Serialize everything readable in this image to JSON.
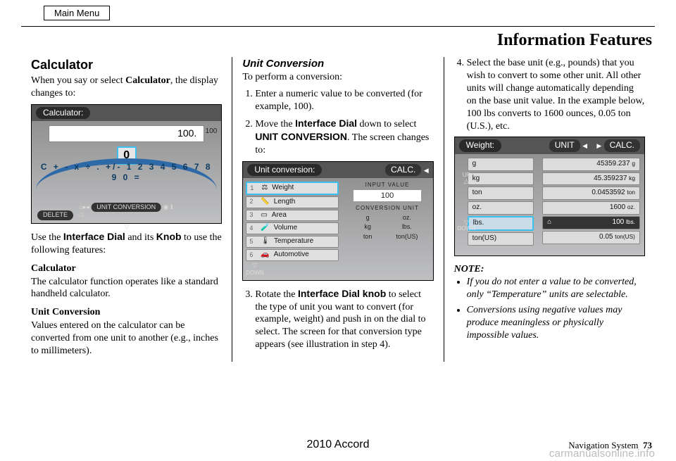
{
  "main_menu_label": "Main Menu",
  "page_title": "Information Features",
  "col1": {
    "h_calculator": "Calculator",
    "intro_pre": "When you say or select ",
    "intro_bold": "Calculator",
    "intro_post": ", the display changes to:",
    "use_pre": "Use the ",
    "use_b1": "Interface Dial",
    "use_mid": " and its ",
    "use_b2": "Knob",
    "use_post": " to use the following features:",
    "sub_calc": "Calculator",
    "sub_calc_text": "The calculator function operates like a standard handheld calculator.",
    "sub_uc": "Unit Conversion",
    "sub_uc_text": "Values entered on the calculator can be converted from one unit to another (e.g., inches to millimeters)."
  },
  "calc_shot": {
    "title": "Calculator:",
    "display_value": "100.",
    "side_value": "100",
    "zero_btn": "0",
    "arc_keys": "C + - x ÷ . +/-  1 2 3 4 5 6 7 8 9 0 =",
    "delete_label": "DELETE",
    "bottom_label": "UNIT CONVERSION"
  },
  "col2": {
    "h_uc": "Unit Conversion",
    "intro": "To perform a conversion:",
    "step1": "Enter a numeric value to be converted (for example, 100).",
    "step2_pre": "Move the ",
    "step2_b1": "Interface Dial",
    "step2_mid": " down to select ",
    "step2_b2": "UNIT CONVERSION",
    "step2_post": ". The screen changes to:",
    "step3_pre": "Rotate the ",
    "step3_b1": "Interface Dial knob",
    "step3_post": " to select the type of unit you want to convert (for example, weight) and push in on the dial to select. The screen for that conversion type appears (see illustration in step 4)."
  },
  "uc_shot": {
    "title": "Unit conversion:",
    "calc_btn": "CALC.",
    "items": [
      {
        "n": "1",
        "icon": "⚖",
        "label": "Weight"
      },
      {
        "n": "2",
        "icon": "📏",
        "label": "Length"
      },
      {
        "n": "3",
        "icon": "▭",
        "label": "Area"
      },
      {
        "n": "4",
        "icon": "🧪",
        "label": "Volume"
      },
      {
        "n": "5",
        "icon": "🌡",
        "label": "Temperature"
      },
      {
        "n": "6",
        "icon": "🚗",
        "label": "Automotive"
      }
    ],
    "input_label": "INPUT VALUE",
    "input_value": "100",
    "conv_label": "CONVERSION UNIT",
    "grid": [
      "g",
      "oz.",
      "kg",
      "lbs.",
      "ton",
      "ton(US)"
    ],
    "down_label": "DOWN"
  },
  "col3": {
    "step4": "Select the base unit (e.g., pounds) that you wish to convert to some other unit. All other units will change automatically depending on the base unit value. In the example below, 100 lbs converts to 1600 ounces, 0.05 ton (U.S.), etc.",
    "note_label": "NOTE:",
    "note1": "If you do not enter a value to be converted, only “Temperature” units are selectable.",
    "note2": "Conversions using negative values may produce meaningless or physically impossible values."
  },
  "wr_shot": {
    "title": "Weight:",
    "unit_btn": "UNIT",
    "calc_btn": "CALC.",
    "left": [
      "g",
      "kg",
      "ton",
      "oz.",
      "lbs.",
      "ton(US)"
    ],
    "right": [
      {
        "v": "45359.237",
        "u": "g"
      },
      {
        "v": "45.359237",
        "u": "kg"
      },
      {
        "v": "0.0453592",
        "u": "ton"
      },
      {
        "v": "1600",
        "u": "oz."
      },
      {
        "v": "100",
        "u": "lbs."
      },
      {
        "v": "0.05",
        "u": "ton(US)"
      }
    ],
    "up": "UP",
    "down": "DOWN"
  },
  "footer": {
    "model": "2010 Accord",
    "section": "Navigation System",
    "page": "73"
  },
  "watermark": "carmanualsonline.info"
}
